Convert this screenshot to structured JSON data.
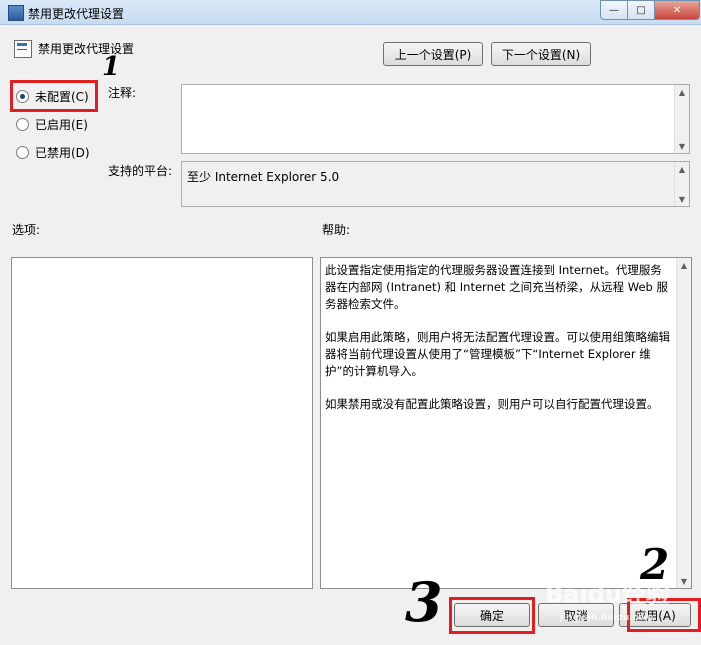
{
  "window": {
    "title": "禁用更改代理设置",
    "min_glyph": "—",
    "max_glyph": "□",
    "close_glyph": "✕"
  },
  "header": {
    "title": "禁用更改代理设置"
  },
  "nav": {
    "prev_label": "上一个设置(P)",
    "next_label": "下一个设置(N)"
  },
  "state_options": [
    {
      "label": "未配置(C)",
      "checked": true
    },
    {
      "label": "已启用(E)",
      "checked": false
    },
    {
      "label": "已禁用(D)",
      "checked": false
    }
  ],
  "comment": {
    "label": "注释:",
    "value": ""
  },
  "platform": {
    "label": "支持的平台:",
    "value": "至少 Internet Explorer 5.0"
  },
  "options": {
    "label": "选项:"
  },
  "help": {
    "label": "帮助:",
    "paragraphs": [
      "此设置指定使用指定的代理服务器设置连接到 Internet。代理服务器在内部网 (Intranet) 和 Internet 之间充当桥梁，从远程 Web 服务器检索文件。",
      "如果启用此策略，则用户将无法配置代理设置。可以使用组策略编辑器将当前代理设置从使用了“管理模板”下“Internet Explorer 维护”的计算机导入。",
      "如果禁用或没有配置此策略设置，则用户可以自行配置代理设置。"
    ]
  },
  "footer": {
    "ok_label": "确定",
    "cancel_label": "取消",
    "apply_label": "应用(A)"
  },
  "annotations": {
    "one": "1",
    "two": "2",
    "three": "3"
  },
  "watermark": {
    "text": "Baidu经验",
    "sub": "jingyan.baidu.com"
  },
  "colors": {
    "highlight": "#e02020"
  }
}
